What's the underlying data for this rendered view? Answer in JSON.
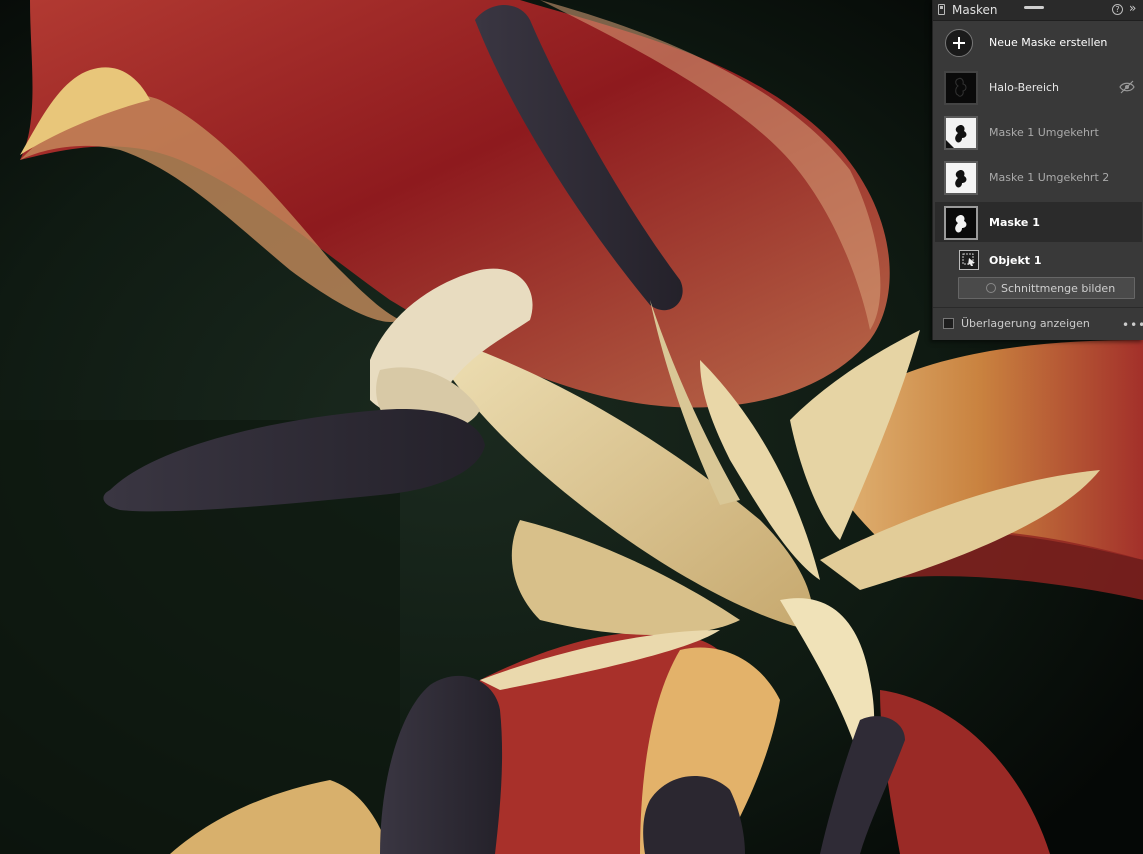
{
  "panel": {
    "title": "Masken",
    "help_symbol": "?",
    "expand_symbol": "»",
    "new_mask_label": "Neue Maske erstellen",
    "masks": [
      {
        "label": "Halo-Bereich",
        "hidden": true
      },
      {
        "label": "Maske 1 Umgekehrt"
      },
      {
        "label": "Maske 1 Umgekehrt 2"
      },
      {
        "label": "Maske 1",
        "selected": true
      }
    ],
    "sub_item_label": "Objekt 1",
    "intersect_button_label": "Schnittmenge bilden",
    "overlay_checkbox_label": "Überlagerung anzeigen",
    "more_label": "•••"
  },
  "colors": {
    "panel_bg": "#393939",
    "selected_row": "#2b2b2b",
    "petal_red": "#8e1a1e",
    "petal_cream": "#e6d4a4",
    "anther_dark": "#2e2a35"
  },
  "icons": [
    "add-icon",
    "eye-hidden-icon",
    "mask-thumbnail",
    "object-icon",
    "intersect-icon",
    "panel-icon",
    "help-icon",
    "expand-icon",
    "more-icon"
  ]
}
